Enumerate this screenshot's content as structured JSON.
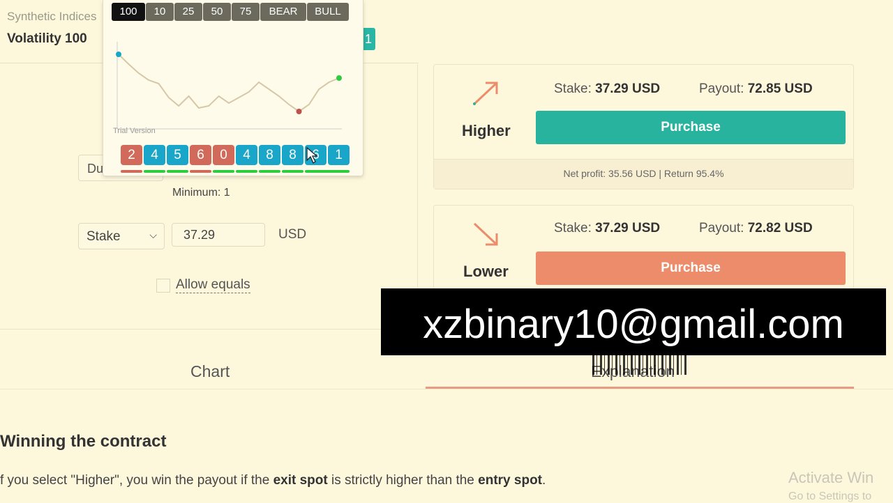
{
  "header": {
    "market_category": "Synthetic Indices",
    "market_name": "Volatility 100",
    "chip_text": "1"
  },
  "popup": {
    "buttons": [
      "100",
      "10",
      "25",
      "50",
      "75",
      "BEAR",
      "BULL"
    ],
    "active_button": "100",
    "watermark": "Trial Version",
    "digits": [
      {
        "value": "2",
        "color": "red"
      },
      {
        "value": "4",
        "color": "blue"
      },
      {
        "value": "5",
        "color": "blue"
      },
      {
        "value": "6",
        "color": "red"
      },
      {
        "value": "0",
        "color": "red"
      },
      {
        "value": "4",
        "color": "blue"
      },
      {
        "value": "8",
        "color": "blue"
      },
      {
        "value": "8",
        "color": "blue"
      },
      {
        "value": "6",
        "color": "blue"
      },
      {
        "value": "1",
        "color": "blue"
      }
    ],
    "bars": [
      "red",
      "green",
      "green",
      "red",
      "green",
      "green",
      "green",
      "green",
      "green"
    ],
    "tick_series": [
      78,
      92,
      105,
      115,
      120,
      140,
      152,
      138,
      155,
      152,
      138,
      148,
      140,
      132,
      118,
      128,
      138,
      150,
      160,
      150,
      128,
      118,
      112
    ]
  },
  "form": {
    "duration_label": "Du",
    "minimum_text": "Minimum: 1",
    "stake_select_label": "Stake",
    "stake_value": "37.29",
    "currency": "USD",
    "allow_equals_label": "Allow equals"
  },
  "higher": {
    "label": "Higher",
    "stake_label": "Stake:",
    "stake_value": "37.29 USD",
    "payout_label": "Payout:",
    "payout_value": "72.85 USD",
    "purchase_label": "Purchase",
    "net_profit": "Net profit: 35.56 USD | Return 95.4%"
  },
  "lower": {
    "label": "Lower",
    "stake_label": "Stake:",
    "stake_value": "37.29 USD",
    "payout_label": "Payout:",
    "payout_value": "72.82 USD",
    "purchase_label": "Purchase"
  },
  "tabs": {
    "chart": "Chart",
    "explanation": "Explanation"
  },
  "explanation": {
    "title": "Winning the contract",
    "text_1": "f you select \"Higher\", you win the payout if the ",
    "bold_1": "exit spot",
    "text_2": " is strictly higher than the ",
    "bold_2": "entry spot",
    "text_3": "."
  },
  "overlay": {
    "email": "xzbinary10@gmail.com",
    "activate_line_1": "Activate Win",
    "activate_line_2": "Go to Settings to"
  },
  "colors": {
    "background": "#fdf7dc",
    "purchase_higher": "#27b39e",
    "purchase_lower": "#ec8c6b",
    "digit_red": "#d26a5c",
    "digit_blue": "#1aa6c8",
    "bar_green": "#2ecc40"
  }
}
